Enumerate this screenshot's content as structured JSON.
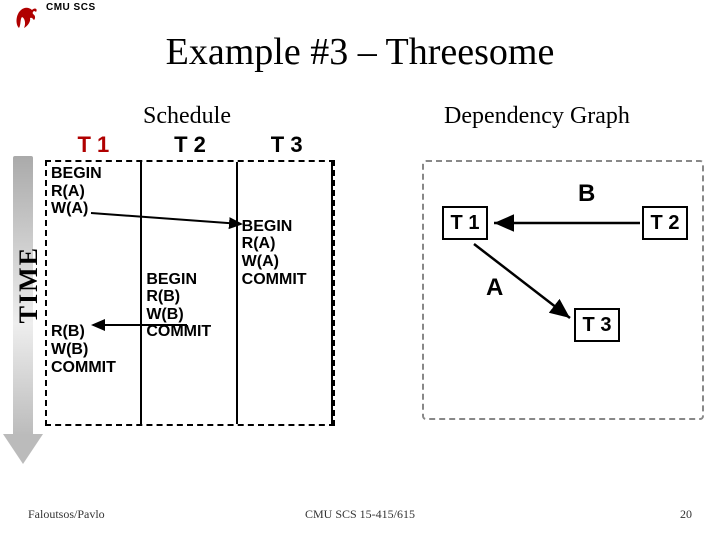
{
  "header": {
    "institution": "CMU SCS"
  },
  "title": "Example #3 – Threesome",
  "schedule": {
    "label": "Schedule",
    "time_label": "TIME",
    "headers": [
      "T 1",
      "T 2",
      "T 3"
    ],
    "columns": [
      "BEGIN\nR(A)\nW(A)\n\n\n\n\n\n\nR(B)\nW(B)\nCOMMIT",
      "\n\n\n\n\n\nBEGIN\nR(B)\nW(B)\nCOMMIT",
      "\n\n\nBEGIN\nR(A)\nW(A)\nCOMMIT"
    ]
  },
  "dependency_graph": {
    "label": "Dependency Graph",
    "nodes": [
      "T 1",
      "T 2",
      "T 3"
    ],
    "edges": [
      {
        "from": "T 2",
        "to": "T 1",
        "label": "B"
      },
      {
        "from": "T 1",
        "to": "T 3",
        "label": "A"
      }
    ],
    "edge_label_B": "B",
    "edge_label_A": "A"
  },
  "footer": {
    "left": "Faloutsos/Pavlo",
    "center": "CMU SCS 15-415/615",
    "right": "20"
  }
}
